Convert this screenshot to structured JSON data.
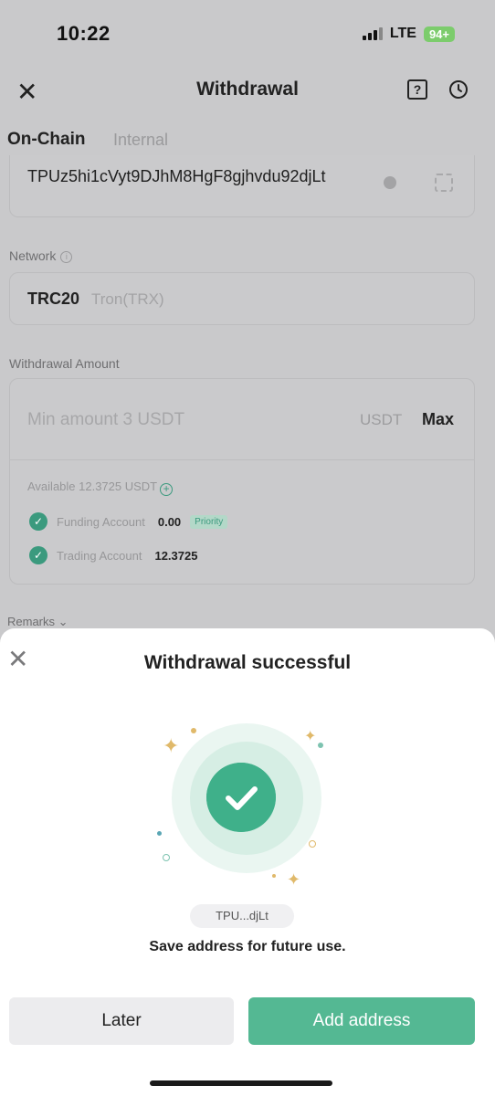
{
  "status_bar": {
    "time": "10:22",
    "network": "LTE",
    "battery": "94+"
  },
  "header": {
    "title": "Withdrawal",
    "help_glyph": "?",
    "close_glyph": "✕"
  },
  "tabs": [
    {
      "label": "On-Chain",
      "active": true
    },
    {
      "label": "Internal",
      "active": false
    }
  ],
  "address": {
    "value": "TPUz5hi1cVyt9DJhM8HgF8gjhvdu92djLt"
  },
  "network": {
    "label": "Network",
    "info_glyph": "i",
    "code": "TRC20",
    "name": "Tron(TRX)"
  },
  "amount": {
    "label": "Withdrawal Amount",
    "placeholder": "Min amount 3 USDT",
    "unit": "USDT",
    "max_label": "Max",
    "available": "Available 12.3725 USDT",
    "accounts": [
      {
        "name": "Funding Account",
        "value": "0.00",
        "badge": "Priority"
      },
      {
        "name": "Trading Account",
        "value": "12.3725"
      }
    ]
  },
  "remarks": {
    "label": "Remarks ⌄"
  },
  "modal": {
    "title": "Withdrawal successful",
    "close_glyph": "✕",
    "address_short": "TPU...djLt",
    "message": "Save address for future use.",
    "later_label": "Later",
    "add_label": "Add address"
  },
  "colors": {
    "accent": "#3fb08a",
    "button_primary": "#54b893",
    "overlay": "#c9c9cb"
  },
  "icons": [
    "close-icon",
    "help-icon",
    "history-icon",
    "info-icon",
    "clear-icon",
    "scan-icon",
    "add-circle-icon",
    "check-icon",
    "success-check-icon",
    "sparkle-icon"
  ]
}
